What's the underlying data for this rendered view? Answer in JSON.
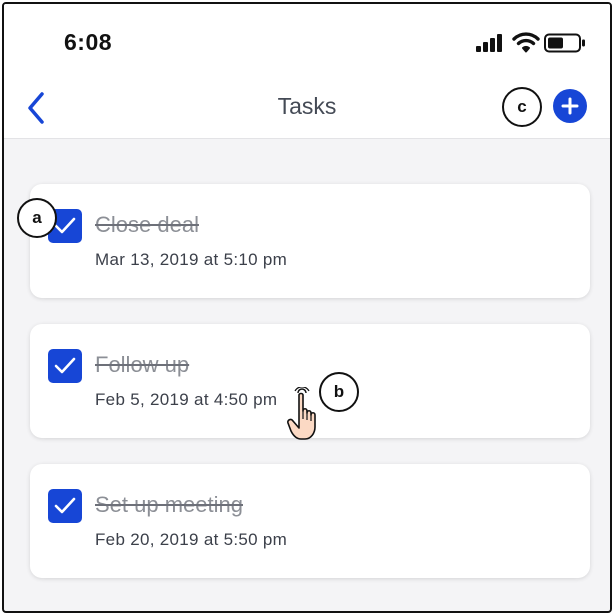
{
  "status_bar": {
    "time": "6:08",
    "icons": [
      "signal-icon",
      "wifi-icon",
      "battery-icon"
    ]
  },
  "nav": {
    "title": "Tasks",
    "back_icon": "chevron-left-icon",
    "add_icon": "plus-icon"
  },
  "tasks": [
    {
      "title": "Close deal",
      "date": "Mar 13, 2019 at 5:10 pm",
      "checked": true
    },
    {
      "title": "Follow up",
      "date": "Feb 5, 2019 at 4:50 pm",
      "checked": true
    },
    {
      "title": "Set up meeting",
      "date": "Feb 20, 2019 at 5:50 pm",
      "checked": true
    }
  ],
  "annotations": {
    "a": "a",
    "b": "b",
    "c": "c"
  },
  "colors": {
    "accent": "#1746d6",
    "background": "#f4f4f6",
    "card": "#ffffff",
    "completed_text": "#8c8f96",
    "date_text": "#3c404a"
  }
}
